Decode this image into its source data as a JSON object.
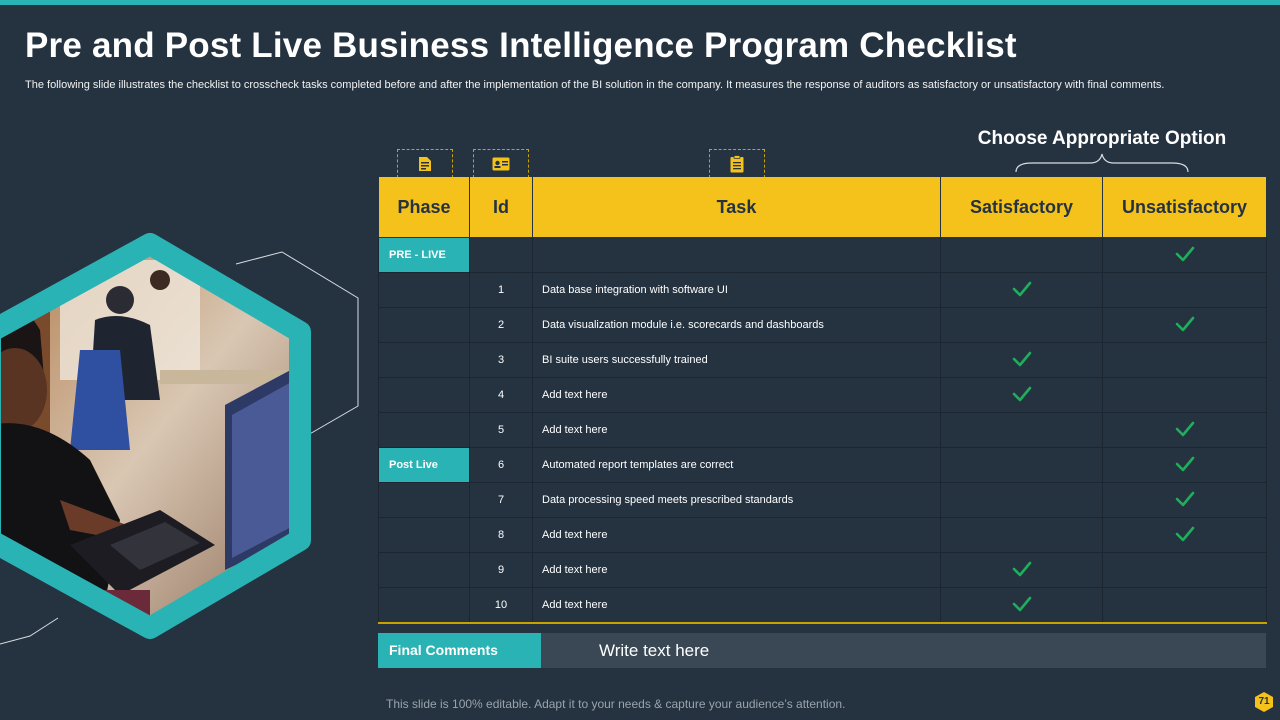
{
  "title": "Pre and Post Live Business Intelligence Program Checklist",
  "subtitle": "The following slide illustrates the checklist to crosscheck tasks completed before and after the implementation of the BI solution in the company. It measures the response of auditors as satisfactory or unsatisfactory with final comments.",
  "choose_label": "Choose Appropriate Option",
  "headers": {
    "phase": "Phase",
    "id": "Id",
    "task": "Task",
    "satisfactory": "Satisfactory",
    "unsatisfactory": "Unsatisfactory"
  },
  "phases": {
    "pre_live": "PRE - LIVE",
    "post_live": "Post Live"
  },
  "rows": [
    {
      "id": "",
      "task": "",
      "result": "unsatisfactory"
    },
    {
      "id": "1",
      "task": "Data base integration with software UI",
      "result": "satisfactory"
    },
    {
      "id": "2",
      "task": "Data visualization module i.e. scorecards and dashboards",
      "result": "unsatisfactory"
    },
    {
      "id": "3",
      "task": "BI suite users successfully trained",
      "result": "satisfactory"
    },
    {
      "id": "4",
      "task": "Add text here",
      "result": "satisfactory"
    },
    {
      "id": "5",
      "task": "Add text here",
      "result": "unsatisfactory"
    },
    {
      "id": "6",
      "task": "Automated report templates are correct",
      "result": "unsatisfactory"
    },
    {
      "id": "7",
      "task": "Data processing speed meets prescribed standards",
      "result": "unsatisfactory"
    },
    {
      "id": "8",
      "task": "Add text here",
      "result": "unsatisfactory"
    },
    {
      "id": "9",
      "task": "Add text here",
      "result": "satisfactory"
    },
    {
      "id": "10",
      "task": "Add text here",
      "result": "satisfactory"
    }
  ],
  "final_comments": {
    "label": "Final Comments",
    "text": "Write text here"
  },
  "footer": "This slide is 100% editable. Adapt it to your needs & capture your audience’s attention.",
  "page_number": "71",
  "colors": {
    "background": "#253341",
    "accent_teal": "#2ab3b5",
    "header_yellow": "#f4c21b",
    "check_green": "#1fae5b"
  },
  "icons": {
    "phase": "document-icon",
    "id": "id-card-icon",
    "task": "clipboard-icon",
    "check": "checkmark-icon"
  }
}
